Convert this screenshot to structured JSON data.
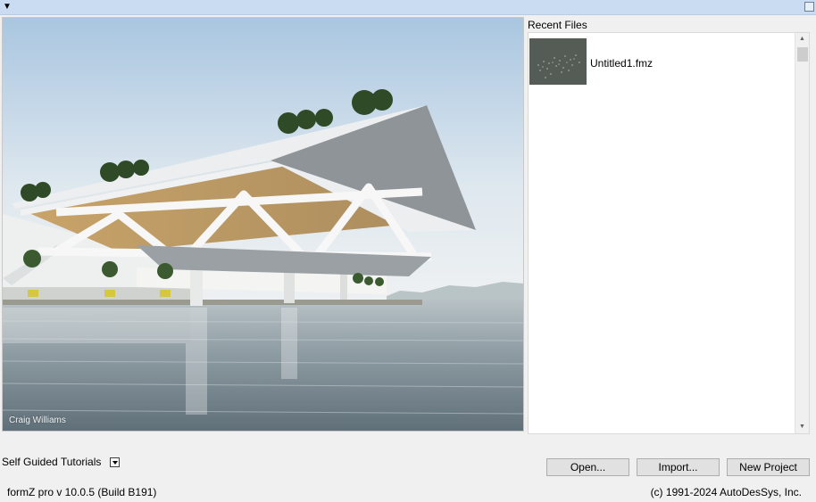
{
  "titlebar": {
    "menu_icon": "menu-triangle-icon",
    "close_icon": "close-icon"
  },
  "hero": {
    "credit": "Craig Williams"
  },
  "recent": {
    "header": "Recent Files",
    "items": [
      {
        "name": "Untitled1.fmz"
      }
    ]
  },
  "tutorials": {
    "label": "Self Guided Tutorials"
  },
  "buttons": {
    "open": "Open...",
    "import": "Import...",
    "new_project": "New Project"
  },
  "footer": {
    "version": "formZ pro v 10.0.5 (Build B191)",
    "copyright": "(c) 1991-2024 AutoDesSys, Inc."
  }
}
